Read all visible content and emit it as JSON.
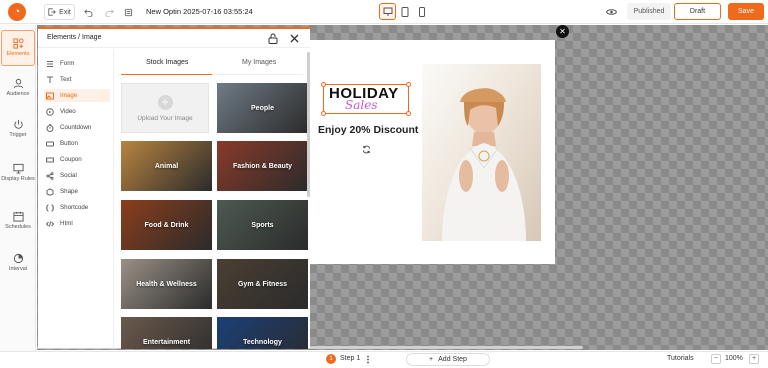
{
  "topbar": {
    "exit_label": "Exit",
    "title": "New Optin 2025-07-16 03:55:24",
    "published_label": "Published",
    "draft_label": "Draft",
    "save_label": "Save"
  },
  "sidebar": {
    "items": [
      {
        "label": "Elements",
        "icon": "elements-icon",
        "active": true
      },
      {
        "label": "Audience",
        "icon": "audience-icon"
      },
      {
        "label": "Trigger",
        "icon": "power-icon"
      },
      {
        "label": "Display Rules",
        "icon": "display-icon"
      },
      {
        "label": "Schedules",
        "icon": "calendar-icon"
      },
      {
        "label": "Interval",
        "icon": "interval-icon"
      }
    ]
  },
  "panel": {
    "title": "Elements / Image",
    "elements": [
      {
        "label": "Form",
        "icon": "form-icon"
      },
      {
        "label": "Text",
        "icon": "text-icon"
      },
      {
        "label": "Image",
        "icon": "image-icon",
        "active": true
      },
      {
        "label": "Video",
        "icon": "video-icon"
      },
      {
        "label": "Countdown",
        "icon": "countdown-icon"
      },
      {
        "label": "Button",
        "icon": "button-icon"
      },
      {
        "label": "Coupon",
        "icon": "coupon-icon"
      },
      {
        "label": "Social",
        "icon": "share-icon"
      },
      {
        "label": "Shape",
        "icon": "shape-icon"
      },
      {
        "label": "Shortcode",
        "icon": "shortcode-icon"
      },
      {
        "label": "Html",
        "icon": "code-icon"
      }
    ],
    "tabs": {
      "stock": "Stock Images",
      "mine": "My Images"
    },
    "upload_label": "Upload Your Image",
    "tiles": [
      {
        "label": "People",
        "color": "#6f7b86"
      },
      {
        "label": "Animal",
        "color": "#b98440"
      },
      {
        "label": "Fashion & Beauty",
        "color": "#8a3a2a"
      },
      {
        "label": "Food & Drink",
        "color": "#8b3e1c"
      },
      {
        "label": "Sports",
        "color": "#4d5a52"
      },
      {
        "label": "Health & Wellness",
        "color": "#9a9186"
      },
      {
        "label": "Gym & Fitness",
        "color": "#4a3f33"
      },
      {
        "label": "Entertainment",
        "color": "#6b5a4c"
      },
      {
        "label": "Technology",
        "color": "#1b3f78"
      }
    ]
  },
  "popup": {
    "heading_line1": "HOLIDAY",
    "heading_line2": "Sales",
    "discount_text": "Enjoy 20% Discount"
  },
  "bottombar": {
    "step_number": "1",
    "step_label": "Step 1",
    "add_step_label": "Add Step",
    "tutorials_label": "Tutorials",
    "zoom_label": "100%"
  },
  "colors": {
    "accent": "#f06a1d"
  }
}
